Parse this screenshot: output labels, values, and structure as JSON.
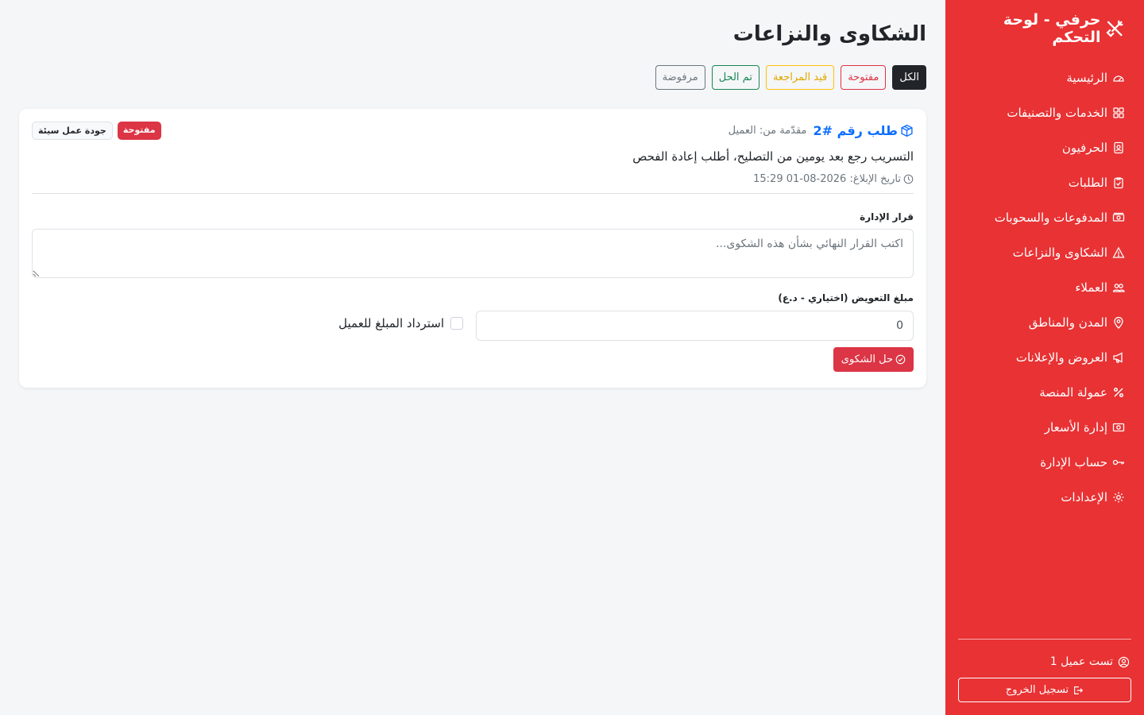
{
  "sidebar": {
    "brand": "حرفي - لوحة التحكم",
    "brand_icon": "tools-icon",
    "items": [
      {
        "label": "الرئيسية",
        "icon": "speedometer-icon"
      },
      {
        "label": "الخدمات والتصنيفات",
        "icon": "grid-icon"
      },
      {
        "label": "الحرفيون",
        "icon": "person-badge-icon"
      },
      {
        "label": "الطلبات",
        "icon": "clipboard-check-icon"
      },
      {
        "label": "المدفوعات والسحوبات",
        "icon": "cash-stack-icon"
      },
      {
        "label": "الشكاوى والنزاعات",
        "icon": "warning-icon"
      },
      {
        "label": "العملاء",
        "icon": "people-icon"
      },
      {
        "label": "المدن والمناطق",
        "icon": "geo-pin-icon"
      },
      {
        "label": "العروض والإعلانات",
        "icon": "megaphone-icon"
      },
      {
        "label": "عمولة المنصة",
        "icon": "percent-icon"
      },
      {
        "label": "إدارة الأسعار",
        "icon": "cash-icon"
      },
      {
        "label": "حساب الإدارة",
        "icon": "key-icon"
      },
      {
        "label": "الإعدادات",
        "icon": "gear-icon"
      }
    ],
    "user": "تست عميل 1",
    "logout": "تسجيل الخروج"
  },
  "main": {
    "title": "الشكاوى والنزاعات",
    "filters": {
      "all": "الكل",
      "open": "مفتوحة",
      "review": "قيد المراجعة",
      "resolved": "تم الحل",
      "rejected": "مرفوضة"
    },
    "complaint": {
      "order": "طلب رقم #2",
      "submitted_by": "مقدّمة من: العميل",
      "status_badge": "مفتوحة",
      "type_badge": "جودة عمل سيئة",
      "description": "التسريب رجع بعد يومين من التصليح، أطلب إعادة الفحص",
      "report_date": "تاريخ الإبلاغ: 2026-08-01 15:29",
      "decision_label": "قرار الإدارة",
      "decision_placeholder": "اكتب القرار النهائي بشأن هذه الشكوى...",
      "amount_label": "مبلغ التعويض (اختياري - د.ع)",
      "amount_value": "0",
      "refund_label": "استرداد المبلغ للعميل",
      "resolve_button": "حل الشكوى"
    }
  },
  "colors": {
    "sidebar_bg": "#e83234",
    "danger": "#dc3545",
    "primary": "#0d6efd",
    "warning": "#ffc107",
    "success": "#198754",
    "secondary": "#6c757d"
  }
}
